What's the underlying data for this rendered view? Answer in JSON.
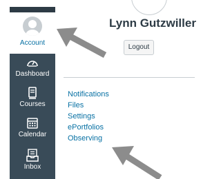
{
  "sidebar": {
    "items": [
      {
        "label": "Account",
        "icon": "account-avatar-icon",
        "active": true
      },
      {
        "label": "Dashboard",
        "icon": "dashboard-gauge-icon"
      },
      {
        "label": "Courses",
        "icon": "courses-book-icon"
      },
      {
        "label": "Calendar",
        "icon": "calendar-icon"
      },
      {
        "label": "Inbox",
        "icon": "inbox-icon"
      }
    ]
  },
  "profile": {
    "name": "Lynn Gutzwiller",
    "logout_label": "Logout"
  },
  "links": [
    "Notifications",
    "Files",
    "Settings",
    "ePortfolios",
    "Observing"
  ],
  "colors": {
    "sidebar_bg": "#394b58",
    "link_blue": "#0770a3",
    "arrow_gray": "#8c8c8c"
  }
}
